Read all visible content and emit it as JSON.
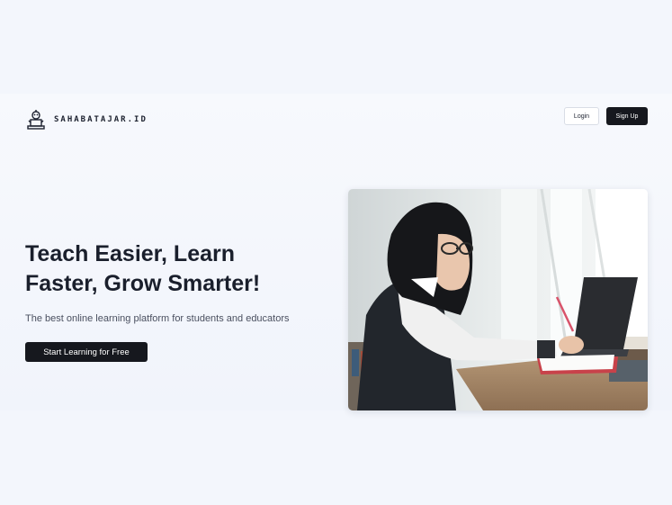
{
  "brand": {
    "name": "SAHABATAJAR.ID",
    "logo_icon": "robot-desk-icon"
  },
  "nav": {
    "login_label": "Login",
    "signup_label": "Sign Up"
  },
  "hero": {
    "title_line1": "Teach Easier, Learn",
    "title_line2": "Faster, Grow Smarter!",
    "subtitle": "The best online learning platform for students and educators",
    "cta_label": "Start Learning for Free",
    "image_alt": "Student studying with a laptop"
  },
  "colors": {
    "background": "#f3f6fc",
    "primary_dark": "#16181e",
    "text": "#1a1f2c",
    "muted_text": "#4a5060"
  }
}
